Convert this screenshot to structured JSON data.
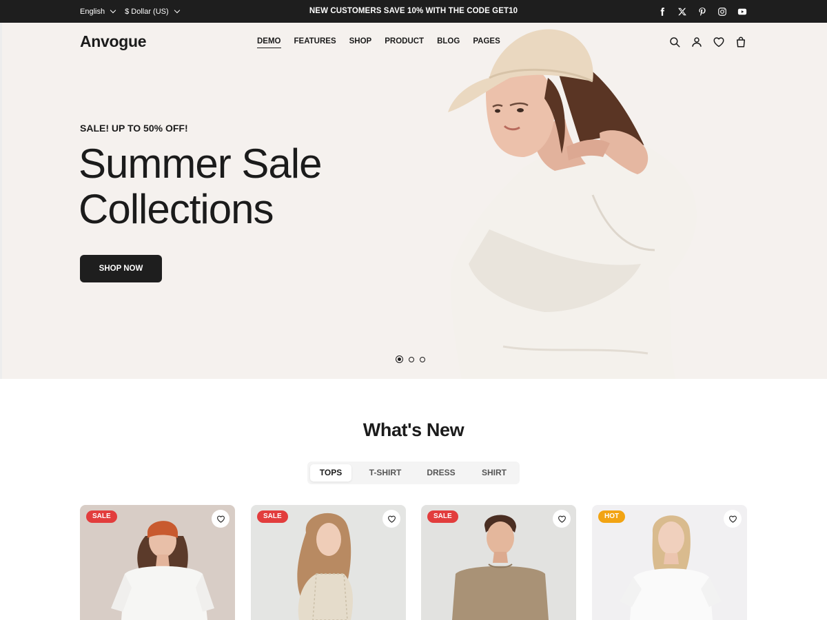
{
  "topbar": {
    "language": "English",
    "currency": "$ Dollar (US)",
    "promo": "NEW CUSTOMERS SAVE 10% WITH THE CODE GET10",
    "social_icons": [
      "facebook-icon",
      "x-icon",
      "pinterest-icon",
      "instagram-icon",
      "youtube-icon"
    ]
  },
  "header": {
    "logo": "Anvogue",
    "nav": [
      "DEMO",
      "FEATURES",
      "SHOP",
      "PRODUCT",
      "BLOG",
      "PAGES"
    ],
    "active_nav": "DEMO",
    "icons": [
      "search-icon",
      "user-icon",
      "heart-icon",
      "cart-icon"
    ]
  },
  "hero": {
    "kicker": "SALE! UP TO 50% OFF!",
    "title_line1": "Summer Sale",
    "title_line2": "Collections",
    "cta": "SHOP NOW",
    "slides_count": 3,
    "active_slide": 1,
    "background": "#f5f1ee"
  },
  "whats_new": {
    "title": "What's New",
    "tabs": [
      "TOPS",
      "T-SHIRT",
      "DRESS",
      "SHIRT"
    ],
    "active_tab": "TOPS",
    "products": [
      {
        "badge": "SALE",
        "badge_color": "#e23d3d"
      },
      {
        "badge": "SALE",
        "badge_color": "#e23d3d"
      },
      {
        "badge": "SALE",
        "badge_color": "#e23d3d"
      },
      {
        "badge": "HOT",
        "badge_color": "#f2a413"
      }
    ]
  },
  "colors": {
    "dark": "#1e1e1e",
    "sale": "#e23d3d",
    "hot": "#f2a413"
  }
}
